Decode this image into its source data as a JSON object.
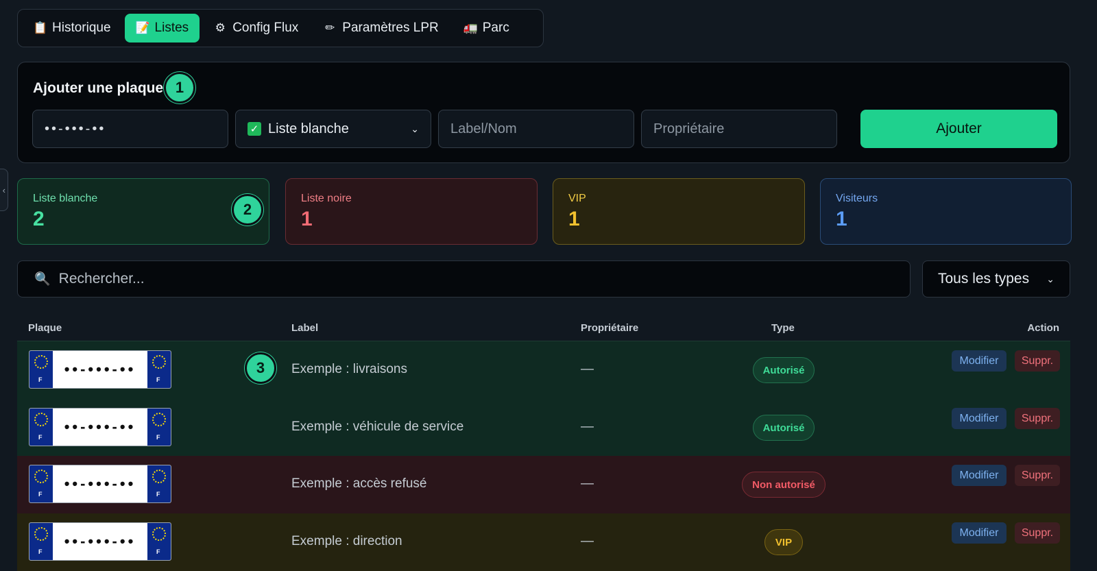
{
  "tabs": [
    {
      "icon": "📋",
      "icon_name": "clipboard-icon",
      "label": "Historique",
      "active": false
    },
    {
      "icon": "📝",
      "icon_name": "memo-icon",
      "label": "Listes",
      "active": true
    },
    {
      "icon": "⚙",
      "icon_name": "gear-icon",
      "label": "Config Flux",
      "active": false
    },
    {
      "icon": "✏",
      "icon_name": "pencil-icon",
      "label": "Paramètres LPR",
      "active": false
    },
    {
      "icon": "🚛",
      "icon_name": "truck-icon",
      "label": "Parc",
      "active": false
    }
  ],
  "add_form": {
    "title": "Ajouter une plaque",
    "plate_value": "••-•••-••",
    "list_select": "Liste blanche",
    "label_placeholder": "Label/Nom",
    "owner_placeholder": "Propriétaire",
    "submit_label": "Ajouter"
  },
  "markers": [
    "1",
    "2",
    "3"
  ],
  "stats": [
    {
      "label": "Liste blanche",
      "value": "2"
    },
    {
      "label": "Liste noire",
      "value": "1"
    },
    {
      "label": "VIP",
      "value": "1"
    },
    {
      "label": "Visiteurs",
      "value": "1"
    }
  ],
  "search": {
    "placeholder": "Rechercher...",
    "type_filter": "Tous les types"
  },
  "table": {
    "headers": {
      "plate": "Plaque",
      "label": "Label",
      "owner": "Propriétaire",
      "type": "Type",
      "action": "Action"
    },
    "rows": [
      {
        "plate": "••-•••-••",
        "eu_letter": "F",
        "label": "Exemple : livraisons",
        "owner": "—",
        "type": "Autorisé",
        "kind": "ok"
      },
      {
        "plate": "••-•••-••",
        "eu_letter": "F",
        "label": "Exemple : véhicule de service",
        "owner": "—",
        "type": "Autorisé",
        "kind": "ok"
      },
      {
        "plate": "••-•••-••",
        "eu_letter": "F",
        "label": "Exemple : accès refusé",
        "owner": "—",
        "type": "Non autorisé",
        "kind": "no"
      },
      {
        "plate": "••-•••-••",
        "eu_letter": "F",
        "label": "Exemple : direction",
        "owner": "—",
        "type": "VIP",
        "kind": "vip"
      }
    ],
    "edit_label": "Modifier",
    "delete_label": "Suppr."
  },
  "colors": {
    "accent": "#1fd18e",
    "danger": "#f25b66",
    "vip": "#f2c12e",
    "info": "#5b9cf5"
  }
}
